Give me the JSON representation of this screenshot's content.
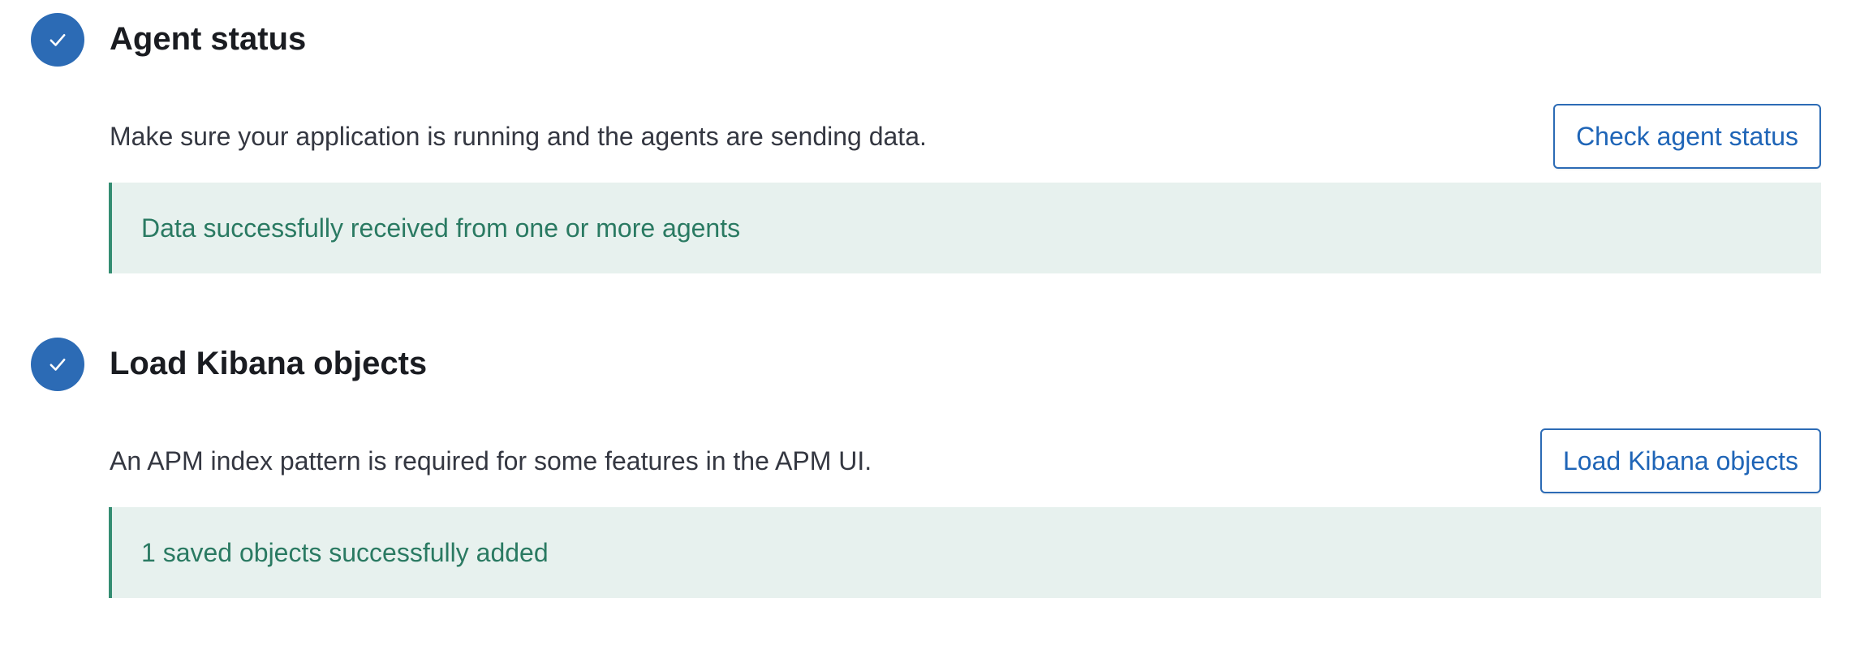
{
  "steps": [
    {
      "status": "complete",
      "status_icon": "check-icon",
      "title": "Agent status",
      "description": "Make sure your application is running and the agents are sending data.",
      "button_label": "Check agent status",
      "callout_text": "Data successfully received from one or more agents"
    },
    {
      "status": "complete",
      "status_icon": "check-icon",
      "title": "Load Kibana objects",
      "description": "An APM index pattern is required for some features in the APM UI.",
      "button_label": "Load Kibana objects",
      "callout_text": "1 saved objects successfully added"
    }
  ],
  "colors": {
    "step_badge": "#2c6bb5",
    "button_text": "#1f65b7",
    "success_background": "#e7f1ee",
    "success_border": "#348d72",
    "success_text": "#2a7a62"
  }
}
